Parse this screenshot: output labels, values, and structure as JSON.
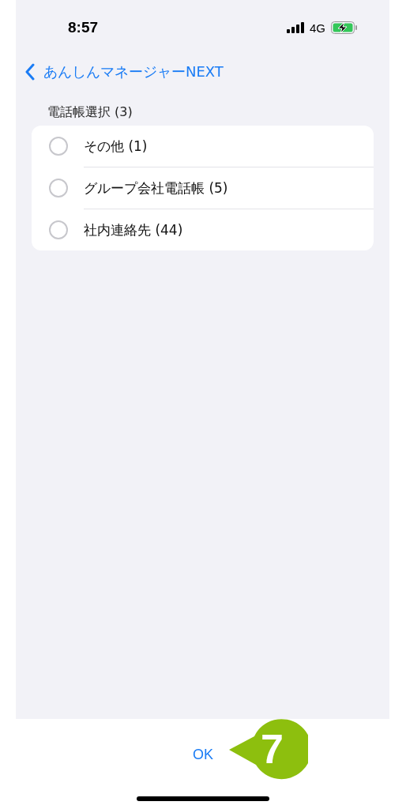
{
  "status_bar": {
    "time": "8:57",
    "network": "4G",
    "charging": true
  },
  "nav": {
    "back_label": "あんしんマネージャーNEXT"
  },
  "section": {
    "title": "電話帳選択 (3)",
    "options": [
      {
        "label": "その他 (1)",
        "selected": false
      },
      {
        "label": "グループ会社電話帳 (5)",
        "selected": false
      },
      {
        "label": "社内連絡先 (44)",
        "selected": false
      }
    ]
  },
  "footer": {
    "button": "OK"
  },
  "callout": {
    "number": "7"
  }
}
